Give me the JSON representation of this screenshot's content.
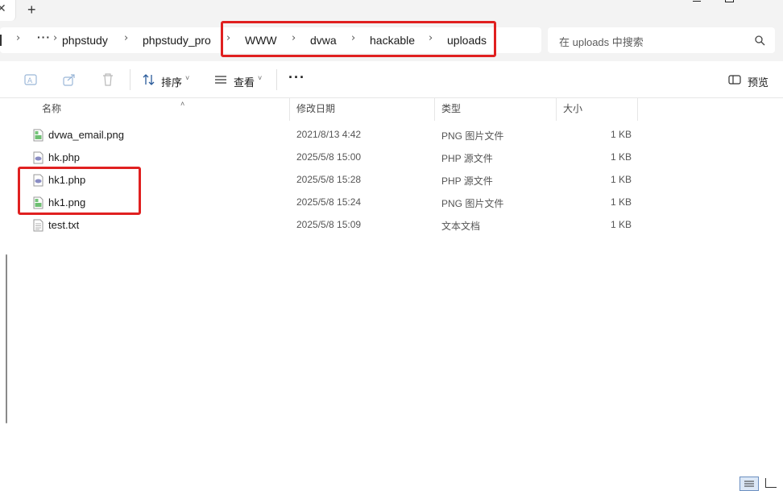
{
  "window": {
    "new_tab_label": "+"
  },
  "breadcrumb": {
    "more_label": "···",
    "items": [
      "phpstudy",
      "phpstudy_pro",
      "WWW",
      "dvwa",
      "hackable",
      "uploads"
    ]
  },
  "search": {
    "placeholder": "在 uploads 中搜索"
  },
  "toolbar": {
    "sort_label": "排序",
    "view_label": "查看",
    "more_label": "···",
    "preview_label": "预览"
  },
  "columns": {
    "name": "名称",
    "modified": "修改日期",
    "type": "类型",
    "size": "大小"
  },
  "files": [
    {
      "name": "dvwa_email.png",
      "modified": "2021/8/13 4:42",
      "type": "PNG 图片文件",
      "size": "1 KB",
      "icon": "png-file-icon"
    },
    {
      "name": "hk.php",
      "modified": "2025/5/8 15:00",
      "type": "PHP 源文件",
      "size": "1 KB",
      "icon": "php-file-icon"
    },
    {
      "name": "hk1.php",
      "modified": "2025/5/8 15:28",
      "type": "PHP 源文件",
      "size": "1 KB",
      "icon": "php-file-icon"
    },
    {
      "name": "hk1.png",
      "modified": "2025/5/8 15:24",
      "type": "PNG 图片文件",
      "size": "1 KB",
      "icon": "png-file-icon"
    },
    {
      "name": "test.txt",
      "modified": "2025/5/8 15:09",
      "type": "文本文档",
      "size": "1 KB",
      "icon": "txt-file-icon"
    }
  ],
  "colors": {
    "highlight": "#e02020",
    "chrome_bg": "#f3f3f3"
  }
}
